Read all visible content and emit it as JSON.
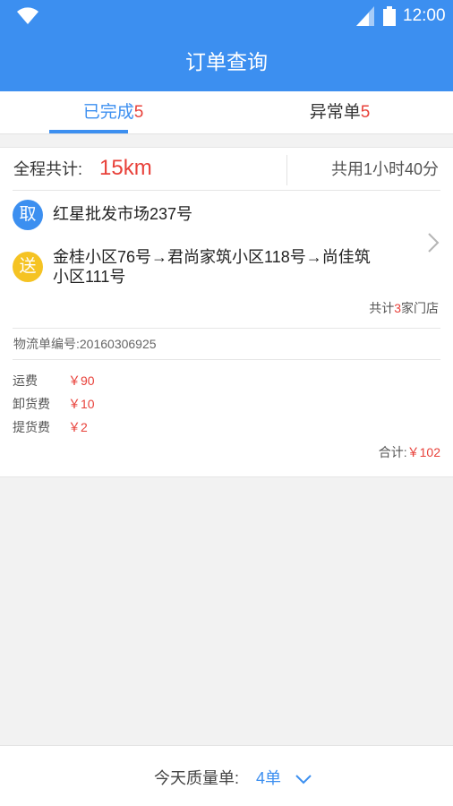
{
  "status_bar": {
    "time": "12:00"
  },
  "header": {
    "title": "订单查询"
  },
  "tabs": [
    {
      "label": "已完成",
      "count": "5"
    },
    {
      "label": "异常单",
      "count": "5"
    }
  ],
  "order": {
    "total_distance_label": "全程共计:",
    "total_distance": "15km",
    "duration": "共用1小时40分",
    "pickup_badge": "取",
    "pickup_address": "红星批发市场237号",
    "deliver_badge": "送",
    "deliver_route": "金桂小区76号→君尚家筑小区118号→尚佳筑小区111号",
    "stores_prefix": "共计",
    "stores_count": "3",
    "stores_suffix": "家门店",
    "waybill": "物流单编号:20160306925",
    "fees": [
      {
        "label": "运费",
        "value": "￥90"
      },
      {
        "label": "卸货费",
        "value": "￥10"
      },
      {
        "label": "提货费",
        "value": "￥2"
      }
    ],
    "sum_label": "合计:",
    "sum_value": "￥102"
  },
  "footer": {
    "label": "今天质量单:",
    "count": "4单"
  },
  "colors": {
    "primary": "#3c8ff0",
    "accent_red": "#e8413a",
    "deliver_yellow": "#f5c323"
  }
}
